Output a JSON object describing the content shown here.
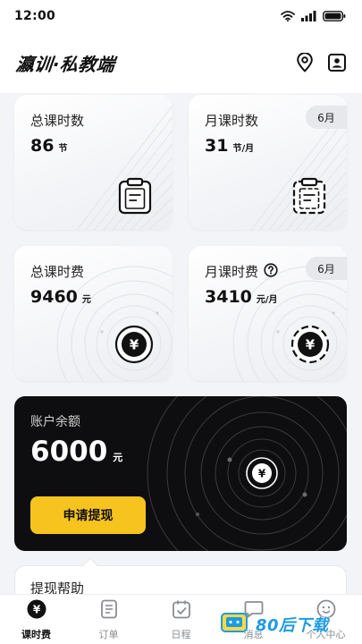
{
  "status_bar": {
    "time": "12:00"
  },
  "header": {
    "brand": "瀛训·私教端",
    "location_icon": "location-pin-icon",
    "profile_icon": "contact-card-icon"
  },
  "cards": {
    "total_hours": {
      "title": "总课时数",
      "value": "86",
      "unit": "节",
      "icon": "clipboard-icon"
    },
    "monthly_hours": {
      "title": "月课时数",
      "value": "31",
      "unit": "节/月",
      "month": "6月",
      "icon": "clipboard-dashed-icon"
    },
    "total_fee": {
      "title": "总课时费",
      "value": "9460",
      "unit": "元",
      "icon": "yuan-coin-icon"
    },
    "monthly_fee": {
      "title": "月课时费",
      "value": "3410",
      "unit": "元/月",
      "month": "6月",
      "icon": "yuan-coin-dashed-icon",
      "help_icon": "question-circle-icon"
    }
  },
  "balance": {
    "title": "账户余额",
    "value": "6000",
    "unit": "元",
    "button_label": "申请提现",
    "icon": "yuan-coin-icon"
  },
  "help": {
    "title": "提现帮助"
  },
  "tabs": [
    {
      "label": "课时费",
      "icon": "yuan-coin-icon",
      "active": true
    },
    {
      "label": "订单",
      "icon": "document-icon",
      "active": false
    },
    {
      "label": "日程",
      "icon": "calendar-check-icon",
      "active": false
    },
    {
      "label": "消息",
      "icon": "chat-bubble-icon",
      "active": false
    },
    {
      "label": "个人中心",
      "icon": "smiley-face-icon",
      "active": false
    }
  ],
  "watermark": {
    "text": "80后下载"
  },
  "colors": {
    "accent_yellow": "#f7c31f",
    "balance_bg": "#0e0e10",
    "page_bg": "#f3f4f7",
    "watermark_blue": "#1e9be0"
  }
}
